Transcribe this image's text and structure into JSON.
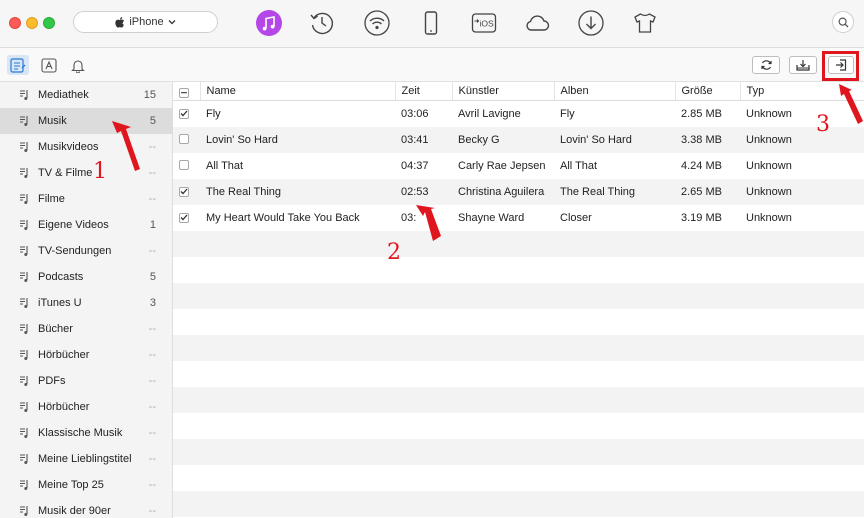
{
  "device": {
    "name": "iPhone"
  },
  "toolbar_icons": [
    "itunes-music-icon",
    "history-icon",
    "wifi-icon",
    "iphone-device-icon",
    "ios-transfer-icon",
    "icloud-icon",
    "download-icon",
    "tshirt-icon"
  ],
  "accent": "#b546e8",
  "sidebar": {
    "items": [
      {
        "label": "Mediathek",
        "count": "15"
      },
      {
        "label": "Musik",
        "count": "5"
      },
      {
        "label": "Musikvideos",
        "count": "--"
      },
      {
        "label": "TV & Filme",
        "count": "--"
      },
      {
        "label": "Filme",
        "count": "--"
      },
      {
        "label": "Eigene Videos",
        "count": "1"
      },
      {
        "label": "TV-Sendungen",
        "count": "--"
      },
      {
        "label": "Podcasts",
        "count": "5"
      },
      {
        "label": "iTunes U",
        "count": "3"
      },
      {
        "label": "Bücher",
        "count": "--"
      },
      {
        "label": "Hörbücher",
        "count": "--"
      },
      {
        "label": "PDFs",
        "count": "--"
      },
      {
        "label": "Hörbücher",
        "count": "--"
      },
      {
        "label": "Klassische Musik",
        "count": "--"
      },
      {
        "label": "Meine Lieblingstitel",
        "count": "--"
      },
      {
        "label": "Meine Top 25",
        "count": "--"
      },
      {
        "label": "Musik der 90er",
        "count": "--"
      }
    ]
  },
  "table": {
    "headers": {
      "name": "Name",
      "time": "Zeit",
      "artist": "Künstler",
      "album": "Alben",
      "size": "Größe",
      "type": "Typ"
    },
    "rows": [
      {
        "checked": true,
        "name": "Fly",
        "time": "03:06",
        "artist": "Avril Lavigne",
        "album": "Fly",
        "size": "2.85 MB",
        "type": "Unknown"
      },
      {
        "checked": false,
        "name": "Lovin' So Hard",
        "time": "03:41",
        "artist": "Becky G",
        "album": "Lovin' So Hard",
        "size": "3.38 MB",
        "type": "Unknown"
      },
      {
        "checked": false,
        "name": "All That",
        "time": "04:37",
        "artist": "Carly Rae Jepsen",
        "album": "All That",
        "size": "4.24 MB",
        "type": "Unknown"
      },
      {
        "checked": true,
        "name": "The Real Thing",
        "time": "02:53",
        "artist": "Christina Aguilera",
        "album": "The Real Thing",
        "size": "2.65 MB",
        "type": "Unknown"
      },
      {
        "checked": true,
        "name": "My Heart Would Take You Back",
        "time": "03:",
        "artist": "Shayne Ward",
        "album": "Closer",
        "size": "3.19 MB",
        "type": "Unknown"
      }
    ]
  },
  "annotations": {
    "one": "1",
    "two": "2",
    "three": "3"
  }
}
